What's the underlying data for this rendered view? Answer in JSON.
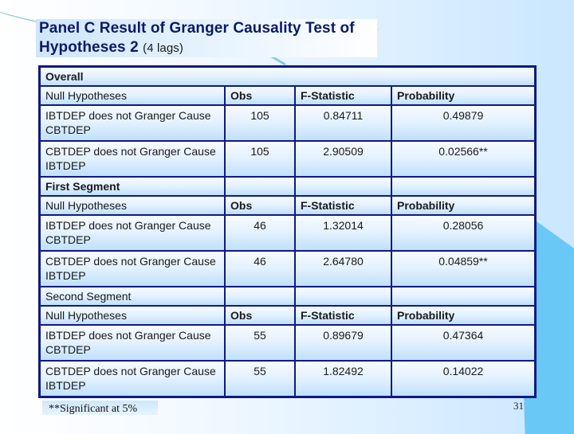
{
  "title": {
    "line1": "Panel C Result of Granger Causality Test of",
    "line2_main": "Hypotheses 2",
    "line2_sub": "(4 lags)"
  },
  "columns": [
    "Null Hypotheses",
    "Obs",
    "F-Statistic",
    "Probability"
  ],
  "sections": [
    {
      "label": "Overall",
      "rows": [
        {
          "hypothesis": "IBTDEP does not Granger Cause CBTDEP",
          "obs": "105",
          "f_stat": "0.84711",
          "prob": "0.49879"
        },
        {
          "hypothesis": "CBTDEP does not Granger Cause IBTDEP",
          "obs": "105",
          "f_stat": "2.90509",
          "prob": "0.02566**"
        }
      ]
    },
    {
      "label": "First Segment",
      "rows": [
        {
          "hypothesis": "IBTDEP does not Granger Cause CBTDEP",
          "obs": "46",
          "f_stat": "1.32014",
          "prob": "0.28056"
        },
        {
          "hypothesis": "CBTDEP does not Granger Cause IBTDEP",
          "obs": "46",
          "f_stat": "2.64780",
          "prob": "0.04859**"
        }
      ]
    },
    {
      "label": "Second Segment",
      "rows": [
        {
          "hypothesis": "IBTDEP does not Granger Cause CBTDEP",
          "obs": "55",
          "f_stat": "0.89679",
          "prob": "0.47364"
        },
        {
          "hypothesis": "CBTDEP does not Granger Cause IBTDEP",
          "obs": "55",
          "f_stat": "1.82492",
          "prob": "0.14022"
        }
      ]
    }
  ],
  "footnote": "**Significant at 5%",
  "page_number": "31",
  "colors": {
    "title": "#0a1a66",
    "table_border": "#101a80",
    "accent_shape": "#6ac8f7"
  }
}
